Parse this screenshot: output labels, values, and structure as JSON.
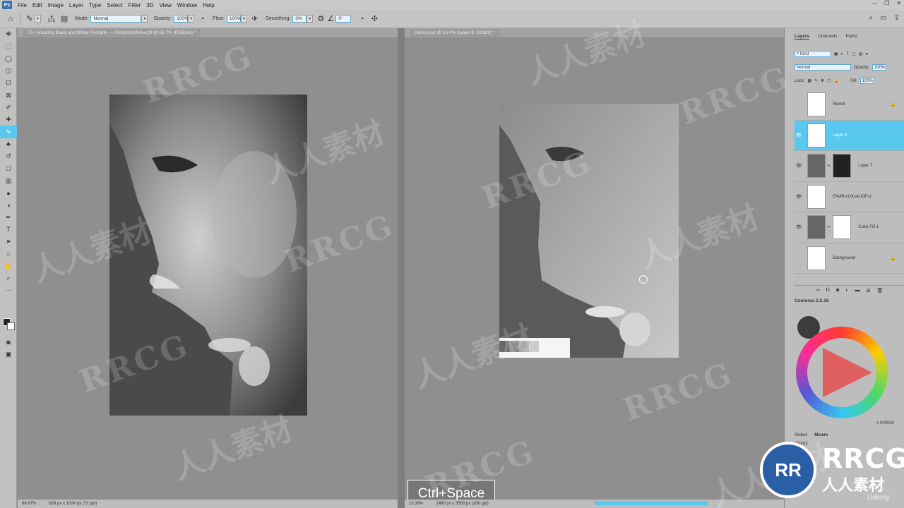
{
  "menu": {
    "logo": "Ps",
    "items": [
      "File",
      "Edit",
      "Image",
      "Layer",
      "Type",
      "Select",
      "Filter",
      "3D",
      "View",
      "Window",
      "Help"
    ]
  },
  "options": {
    "brush_size": "575",
    "mode_label": "Mode:",
    "mode_value": "Normal",
    "opacity_label": "Opacity:",
    "opacity_value": "100%",
    "flow_label": "Flow:",
    "flow_value": "100%",
    "smoothing_label": "Smoothing:",
    "smoothing_value": "0%",
    "angle_value": "0°"
  },
  "documents": [
    {
      "tab": "75+ Amazing Black and White Portraits — Richpointofview.jfif @ 66.7% (RGB/8#) *",
      "zoom": "66.67%",
      "size": "628 px x 1024 px (72 ppi)"
    },
    {
      "tab": "Demo.psd @ 15.4% (Layer 8, RGB/8) *",
      "zoom": "15.39%",
      "size": "2480 px x 3508 px (300 ppi)"
    }
  ],
  "shortcut": "Ctrl+Space",
  "panels": {
    "tabs": [
      "Layers",
      "Channels",
      "Paths"
    ],
    "kind": "Kind",
    "blend": "Normal",
    "opacity_label": "Opacity:",
    "opacity_value": "100%",
    "lock_label": "Lock:",
    "fill_label": "Fill:",
    "fill_value": "100%",
    "layers": [
      {
        "name": "Sketch",
        "visible": false,
        "locked": true,
        "selected": false
      },
      {
        "name": "Layer 8",
        "visible": true,
        "locked": false,
        "selected": true
      },
      {
        "name": "Layer 7",
        "visible": true,
        "locked": false,
        "selected": false
      },
      {
        "name": "EAvlRrzUXsAUOFsz",
        "visible": true,
        "locked": false,
        "selected": false
      },
      {
        "name": "Color Fill 1",
        "visible": true,
        "locked": false,
        "selected": false
      },
      {
        "name": "Background",
        "visible": false,
        "locked": true,
        "selected": false
      }
    ],
    "coolorus_title": "Coolorus 2.5.16",
    "hex_value": "# 000000",
    "mixer_tabs": [
      "Sliders",
      "Mixers"
    ],
    "mixer_extra": "History"
  },
  "watermark": {
    "latin": "RRCG",
    "cjk": "人人素材"
  },
  "logo": {
    "initials": "RR",
    "title": "RRCG",
    "subtitle": "人人素材"
  },
  "udemy": "Udemy",
  "colors": {
    "accent": "#58c8ef",
    "menubar": "#c9c9c9",
    "canvas": "#8f8f8f"
  }
}
